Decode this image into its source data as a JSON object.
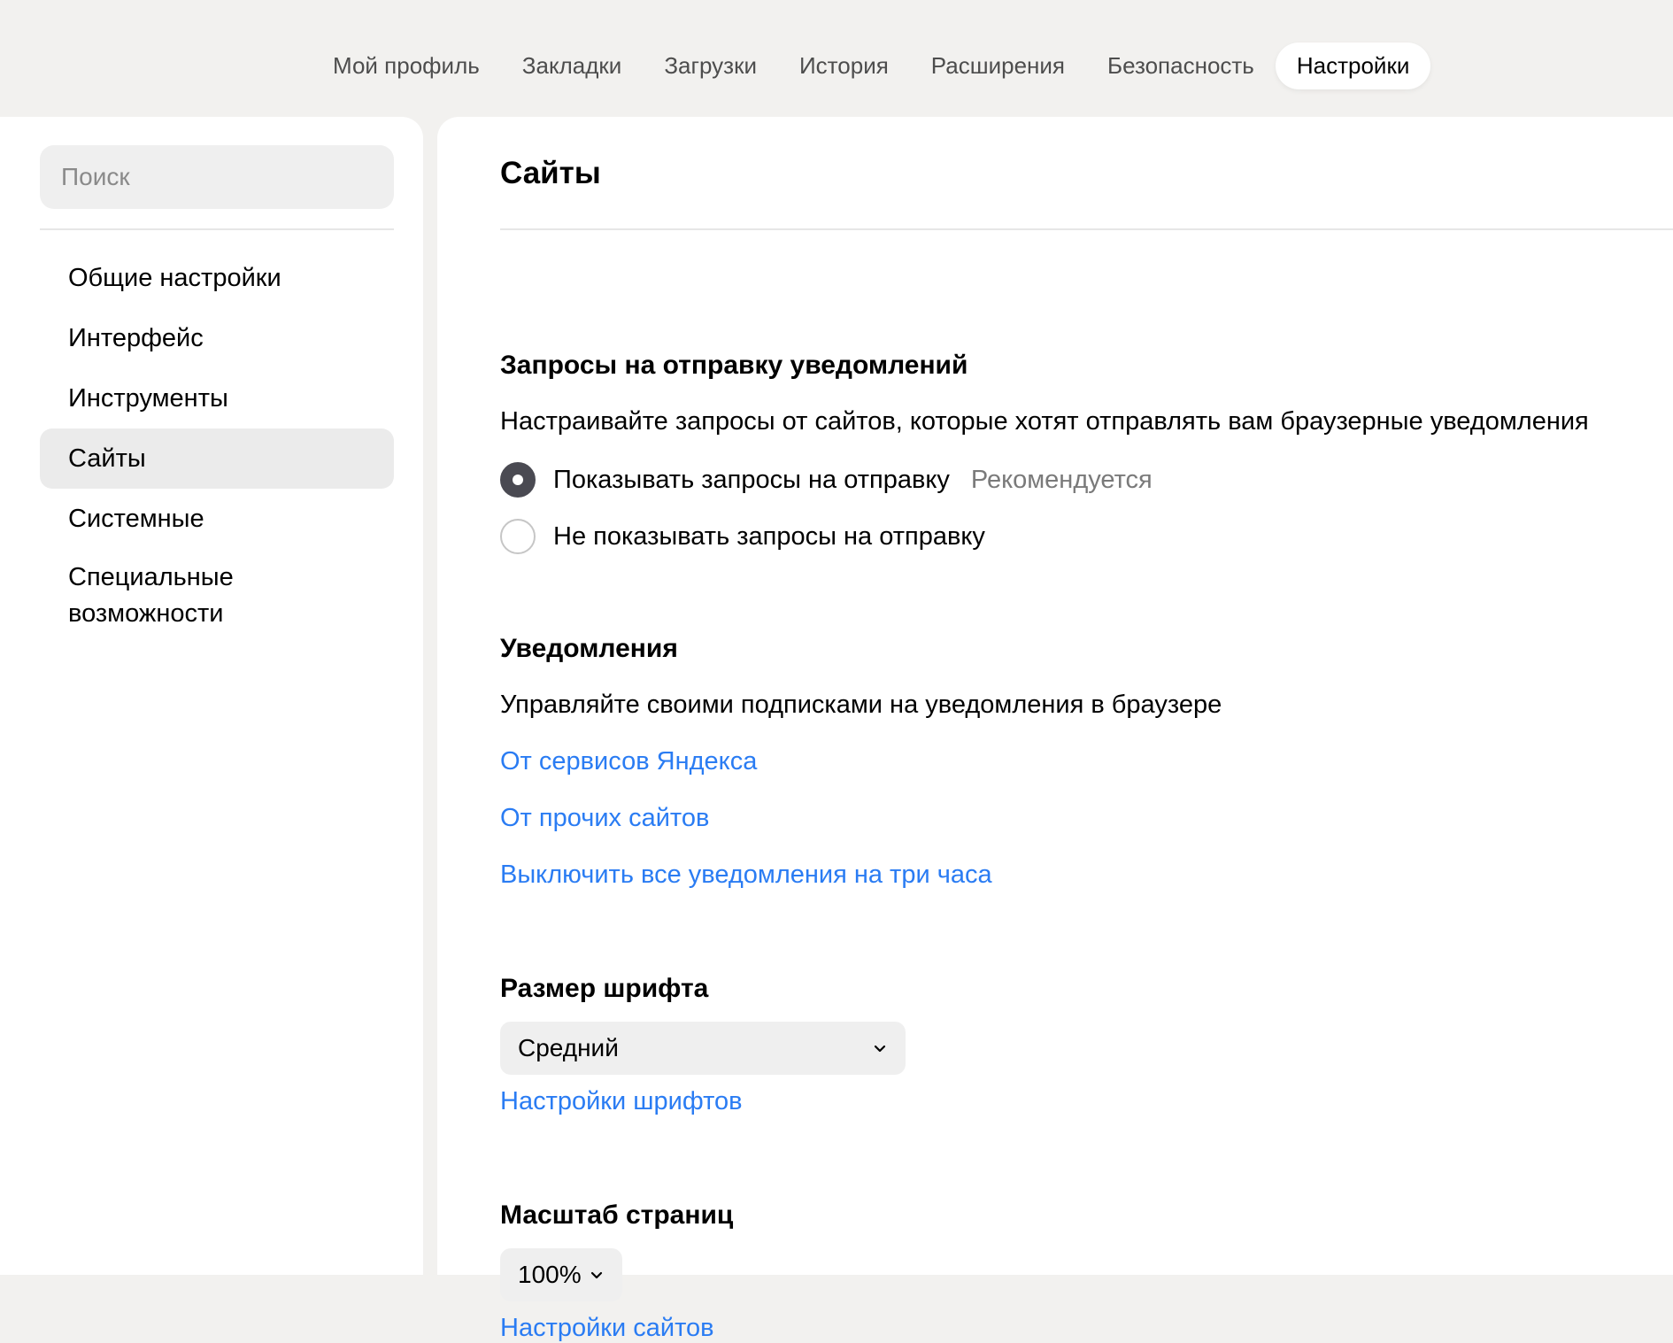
{
  "header": {
    "tabs": [
      {
        "label": "Мой профиль"
      },
      {
        "label": "Закладки"
      },
      {
        "label": "Загрузки"
      },
      {
        "label": "История"
      },
      {
        "label": "Расширения"
      },
      {
        "label": "Безопасность"
      },
      {
        "label": "Настройки",
        "active": true
      }
    ]
  },
  "sidebar": {
    "search_placeholder": "Поиск",
    "items": [
      {
        "label": "Общие настройки"
      },
      {
        "label": "Интерфейс"
      },
      {
        "label": "Инструменты"
      },
      {
        "label": "Сайты",
        "active": true
      },
      {
        "label": "Системные"
      },
      {
        "label": "Специальные возможности"
      }
    ]
  },
  "main": {
    "title": "Сайты",
    "notification_requests": {
      "heading": "Запросы на отправку уведомлений",
      "description": "Настраивайте запросы от сайтов, которые хотят отправлять вам браузерные уведомления",
      "options": [
        {
          "label": "Показывать запросы на отправку",
          "hint": "Рекомендуется",
          "checked": true
        },
        {
          "label": "Не показывать запросы на отправку",
          "checked": false
        }
      ]
    },
    "notifications": {
      "heading": "Уведомления",
      "description": "Управляйте своими подписками на уведомления в браузере",
      "links": [
        "От сервисов Яндекса",
        "От прочих сайтов",
        "Выключить все уведомления на три часа"
      ]
    },
    "font_size": {
      "heading": "Размер шрифта",
      "selected": "Средний",
      "link": "Настройки шрифтов"
    },
    "page_zoom": {
      "heading": "Масштаб страниц",
      "selected": "100%",
      "link": "Настройки сайтов"
    }
  },
  "colors": {
    "background": "#f2f1ef",
    "link": "#2a7cf3",
    "radio_checked": "#4a4a52",
    "nav_active": "#ebebeb"
  },
  "icons": {
    "select_chevron": "chevron-down-icon"
  }
}
